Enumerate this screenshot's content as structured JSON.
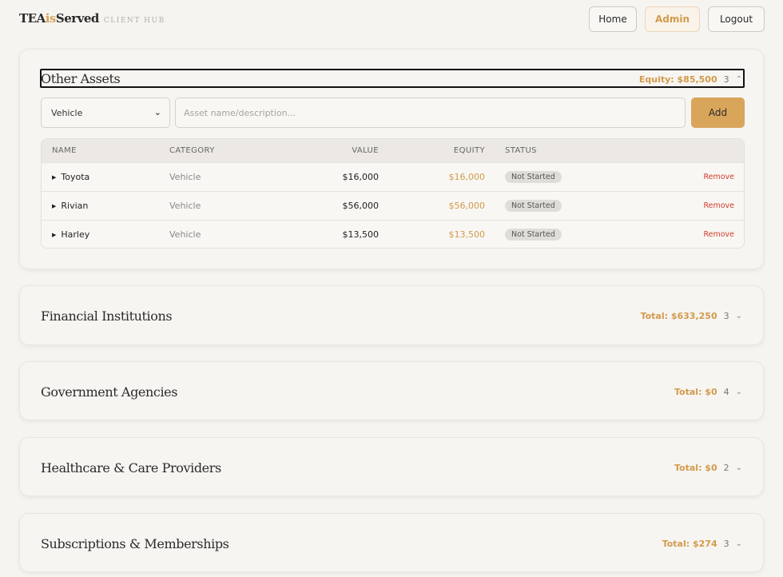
{
  "brand": {
    "part1": "TEA",
    "part2": "is",
    "part3": "Served",
    "sub": "CLIENT HUB"
  },
  "nav": {
    "home": "Home",
    "admin": "Admin",
    "logout": "Logout"
  },
  "colors": {
    "accent": "#d8a55b",
    "remove": "#d23b2b"
  },
  "other_assets": {
    "title": "Other Assets",
    "summary": "Equity: $85,500",
    "count": "3",
    "select_value": "Vehicle",
    "input_placeholder": "Asset name/description...",
    "add_label": "Add",
    "columns": {
      "name": "NAME",
      "category": "CATEGORY",
      "value": "VALUE",
      "equity": "EQUITY",
      "status": "STATUS"
    },
    "rows": [
      {
        "name": "Toyota",
        "category": "Vehicle",
        "value": "$16,000",
        "equity": "$16,000",
        "status": "Not Started",
        "action": "Remove"
      },
      {
        "name": "Rivian",
        "category": "Vehicle",
        "value": "$56,000",
        "equity": "$56,000",
        "status": "Not Started",
        "action": "Remove"
      },
      {
        "name": "Harley",
        "category": "Vehicle",
        "value": "$13,500",
        "equity": "$13,500",
        "status": "Not Started",
        "action": "Remove"
      }
    ]
  },
  "sections": [
    {
      "title": "Financial Institutions",
      "summary": "Total: $633,250",
      "count": "3"
    },
    {
      "title": "Government Agencies",
      "summary": "Total: $0",
      "count": "4"
    },
    {
      "title": "Healthcare & Care Providers",
      "summary": "Total: $0",
      "count": "2"
    },
    {
      "title": "Subscriptions & Memberships",
      "summary": "Total: $274",
      "count": "3"
    }
  ]
}
